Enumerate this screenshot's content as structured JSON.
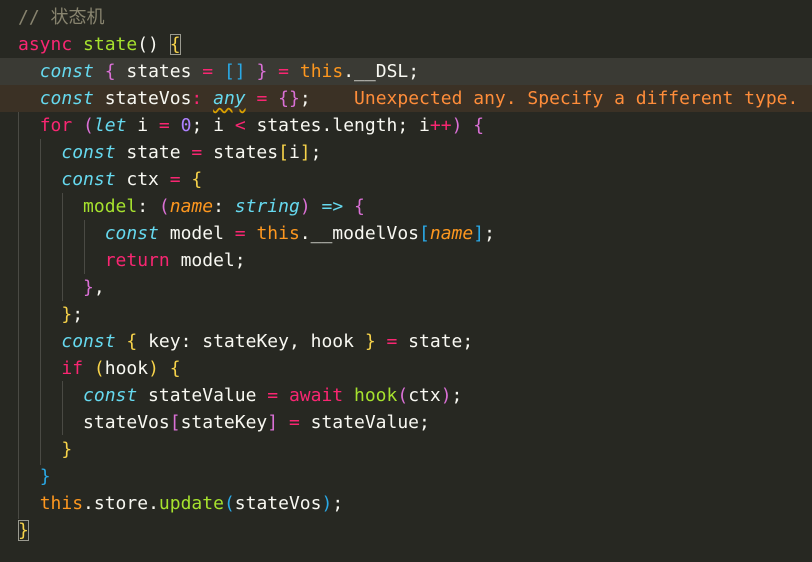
{
  "editor": {
    "background": "#272822",
    "lines": [
      {
        "tokens": [
          {
            "text": "// 状态机",
            "cls": "cm"
          }
        ]
      },
      {
        "tokens": [
          {
            "text": "async ",
            "cls": "k"
          },
          {
            "text": "state",
            "cls": "f"
          },
          {
            "text": "() ",
            "cls": ""
          },
          {
            "text": "{",
            "cls": "b1 boxed"
          }
        ]
      },
      {
        "hl": "active",
        "tokens": [
          {
            "text": "  "
          },
          {
            "text": "const",
            "cls": "ki"
          },
          {
            "text": " "
          },
          {
            "text": "{",
            "cls": "b2"
          },
          {
            "text": " states "
          },
          {
            "text": "=",
            "cls": "op"
          },
          {
            "text": " "
          },
          {
            "text": "[]",
            "cls": "b3"
          },
          {
            "text": " "
          },
          {
            "text": "}",
            "cls": "b2"
          },
          {
            "text": " "
          },
          {
            "text": "=",
            "cls": "op"
          },
          {
            "text": " "
          },
          {
            "text": "this",
            "cls": "this"
          },
          {
            "text": ".__DSL;"
          }
        ]
      },
      {
        "hl": "warn",
        "tokens": [
          {
            "text": "  "
          },
          {
            "text": "const",
            "cls": "ki"
          },
          {
            "text": " stateVos"
          },
          {
            "text": ":",
            "cls": "op"
          },
          {
            "text": " "
          },
          {
            "text": "any",
            "cls": "t squig"
          },
          {
            "text": " "
          },
          {
            "text": "=",
            "cls": "op"
          },
          {
            "text": " "
          },
          {
            "text": "{}",
            "cls": "b2"
          },
          {
            "text": ";    "
          },
          {
            "text": "Unexpected any. Specify a different type.",
            "cls": "warn"
          }
        ]
      },
      {
        "tokens": [
          {
            "text": "  "
          },
          {
            "text": "for",
            "cls": "k"
          },
          {
            "text": " "
          },
          {
            "text": "(",
            "cls": "b2"
          },
          {
            "text": "let",
            "cls": "ki"
          },
          {
            "text": " i "
          },
          {
            "text": "=",
            "cls": "op"
          },
          {
            "text": " "
          },
          {
            "text": "0",
            "cls": "num"
          },
          {
            "text": "; i "
          },
          {
            "text": "<",
            "cls": "op"
          },
          {
            "text": " states.length; i"
          },
          {
            "text": "++",
            "cls": "op"
          },
          {
            "text": ")",
            "cls": "b2"
          },
          {
            "text": " "
          },
          {
            "text": "{",
            "cls": "b2"
          }
        ]
      },
      {
        "tokens": [
          {
            "text": "    "
          },
          {
            "text": "const",
            "cls": "ki"
          },
          {
            "text": " state "
          },
          {
            "text": "=",
            "cls": "op"
          },
          {
            "text": " states"
          },
          {
            "text": "[",
            "cls": "b1"
          },
          {
            "text": "i"
          },
          {
            "text": "]",
            "cls": "b1"
          },
          {
            "text": ";"
          }
        ]
      },
      {
        "tokens": [
          {
            "text": "    "
          },
          {
            "text": "const",
            "cls": "ki"
          },
          {
            "text": " ctx "
          },
          {
            "text": "=",
            "cls": "op"
          },
          {
            "text": " "
          },
          {
            "text": "{",
            "cls": "b1"
          }
        ]
      },
      {
        "tokens": [
          {
            "text": "      "
          },
          {
            "text": "model",
            "cls": "f"
          },
          {
            "text": ": "
          },
          {
            "text": "(",
            "cls": "b2"
          },
          {
            "text": "name",
            "cls": "p"
          },
          {
            "text": ": "
          },
          {
            "text": "string",
            "cls": "t"
          },
          {
            "text": ")",
            "cls": "b2"
          },
          {
            "text": " "
          },
          {
            "text": "=>",
            "cls": "ki"
          },
          {
            "text": " "
          },
          {
            "text": "{",
            "cls": "b2"
          }
        ]
      },
      {
        "tokens": [
          {
            "text": "        "
          },
          {
            "text": "const",
            "cls": "ki"
          },
          {
            "text": " model "
          },
          {
            "text": "=",
            "cls": "op"
          },
          {
            "text": " "
          },
          {
            "text": "this",
            "cls": "this"
          },
          {
            "text": ".__modelVos"
          },
          {
            "text": "[",
            "cls": "b3"
          },
          {
            "text": "name",
            "cls": "p"
          },
          {
            "text": "]",
            "cls": "b3"
          },
          {
            "text": ";"
          }
        ]
      },
      {
        "tokens": [
          {
            "text": "        "
          },
          {
            "text": "return",
            "cls": "k"
          },
          {
            "text": " model;"
          }
        ]
      },
      {
        "tokens": [
          {
            "text": "      "
          },
          {
            "text": "}",
            "cls": "b2"
          },
          {
            "text": ","
          }
        ]
      },
      {
        "tokens": [
          {
            "text": "    "
          },
          {
            "text": "}",
            "cls": "b1"
          },
          {
            "text": ";"
          }
        ]
      },
      {
        "tokens": [
          {
            "text": "    "
          },
          {
            "text": "const",
            "cls": "ki"
          },
          {
            "text": " "
          },
          {
            "text": "{",
            "cls": "b1"
          },
          {
            "text": " key: stateKey, hook "
          },
          {
            "text": "}",
            "cls": "b1"
          },
          {
            "text": " "
          },
          {
            "text": "=",
            "cls": "op"
          },
          {
            "text": " state;"
          }
        ]
      },
      {
        "tokens": [
          {
            "text": "    "
          },
          {
            "text": "if",
            "cls": "k"
          },
          {
            "text": " "
          },
          {
            "text": "(",
            "cls": "b1"
          },
          {
            "text": "hook"
          },
          {
            "text": ")",
            "cls": "b1"
          },
          {
            "text": " "
          },
          {
            "text": "{",
            "cls": "b1"
          }
        ]
      },
      {
        "tokens": [
          {
            "text": "      "
          },
          {
            "text": "const",
            "cls": "ki"
          },
          {
            "text": " stateValue "
          },
          {
            "text": "=",
            "cls": "op"
          },
          {
            "text": " "
          },
          {
            "text": "await",
            "cls": "k"
          },
          {
            "text": " "
          },
          {
            "text": "hook",
            "cls": "f"
          },
          {
            "text": "(",
            "cls": "b2"
          },
          {
            "text": "ctx"
          },
          {
            "text": ")",
            "cls": "b2"
          },
          {
            "text": ";"
          }
        ]
      },
      {
        "tokens": [
          {
            "text": "      stateVos"
          },
          {
            "text": "[",
            "cls": "b2"
          },
          {
            "text": "stateKey"
          },
          {
            "text": "]",
            "cls": "b2"
          },
          {
            "text": " "
          },
          {
            "text": "=",
            "cls": "op"
          },
          {
            "text": " stateValue;"
          }
        ]
      },
      {
        "tokens": [
          {
            "text": "    "
          },
          {
            "text": "}",
            "cls": "b1"
          }
        ]
      },
      {
        "tokens": [
          {
            "text": "  "
          },
          {
            "text": "}",
            "cls": "b3"
          }
        ]
      },
      {
        "tokens": [
          {
            "text": "  "
          },
          {
            "text": "this",
            "cls": "this"
          },
          {
            "text": ".store."
          },
          {
            "text": "update",
            "cls": "f"
          },
          {
            "text": "(",
            "cls": "b3"
          },
          {
            "text": "stateVos"
          },
          {
            "text": ")",
            "cls": "b3"
          },
          {
            "text": ";"
          }
        ]
      },
      {
        "tokens": [
          {
            "text": "}",
            "cls": "b1 boxed"
          }
        ]
      }
    ]
  }
}
